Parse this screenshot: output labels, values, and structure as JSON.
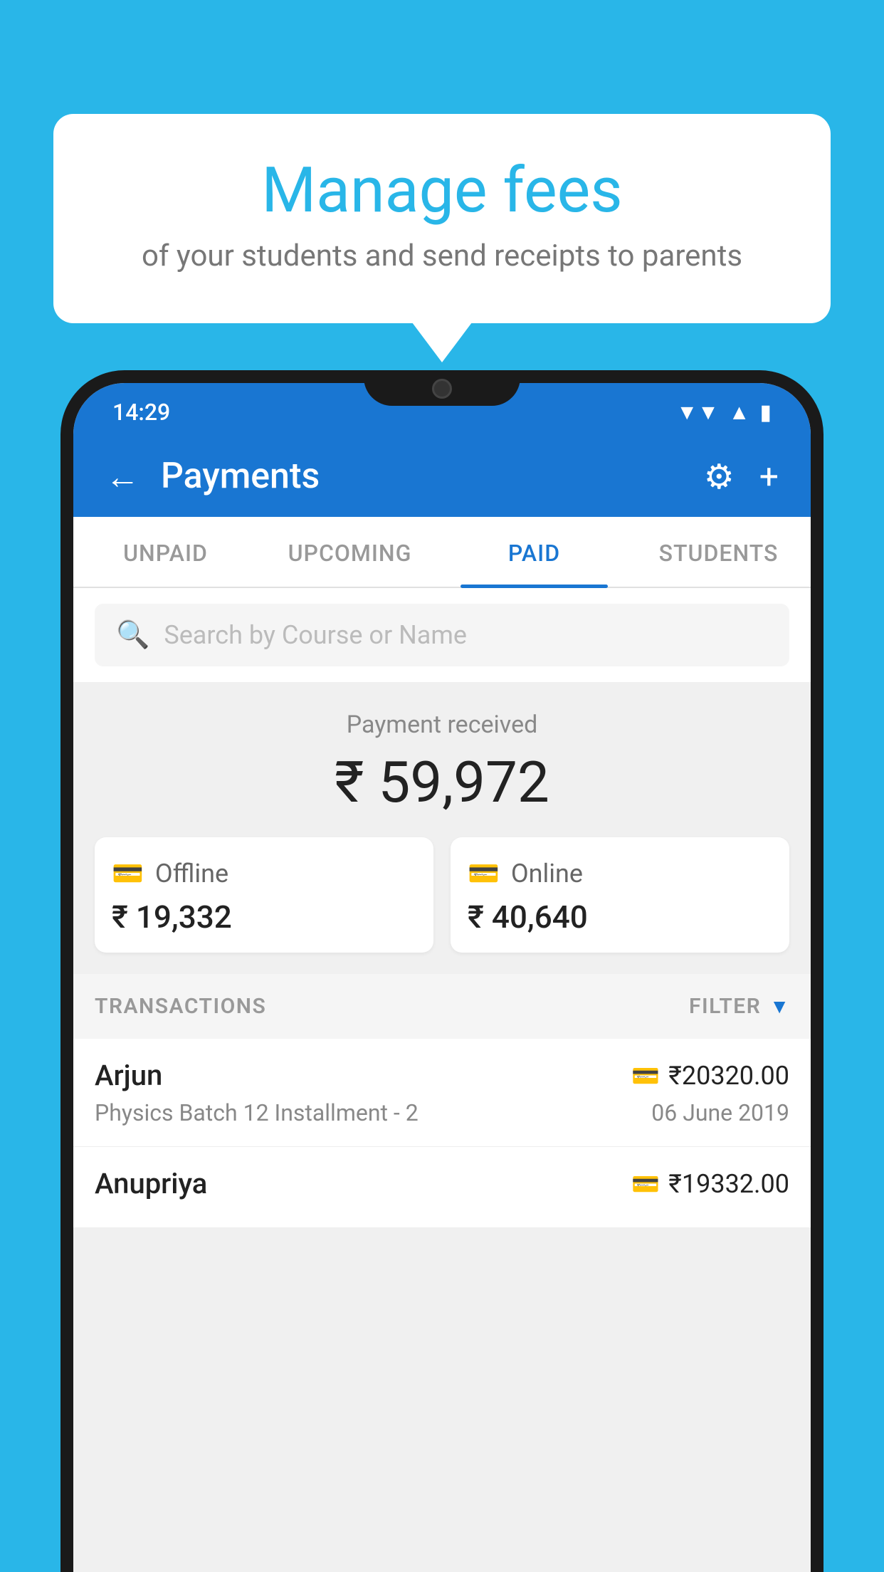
{
  "background_color": "#29b6e8",
  "speech_bubble": {
    "title": "Manage fees",
    "subtitle": "of your students and send receipts to parents"
  },
  "status_bar": {
    "time": "14:29",
    "wifi_icon": "▾",
    "signal_icon": "▲",
    "battery_icon": "▮"
  },
  "app_bar": {
    "title": "Payments",
    "back_icon": "←",
    "settings_icon": "⚙",
    "add_icon": "+"
  },
  "tabs": [
    {
      "label": "UNPAID",
      "active": false
    },
    {
      "label": "UPCOMING",
      "active": false
    },
    {
      "label": "PAID",
      "active": true
    },
    {
      "label": "STUDENTS",
      "active": false
    }
  ],
  "search": {
    "placeholder": "Search by Course or Name"
  },
  "payment_summary": {
    "label": "Payment received",
    "total": "₹ 59,972",
    "offline_label": "Offline",
    "offline_amount": "₹ 19,332",
    "online_label": "Online",
    "online_amount": "₹ 40,640"
  },
  "transactions_header": {
    "label": "TRANSACTIONS",
    "filter_label": "FILTER"
  },
  "transactions": [
    {
      "name": "Arjun",
      "amount": "₹20320.00",
      "course": "Physics Batch 12 Installment - 2",
      "date": "06 June 2019",
      "type": "online"
    },
    {
      "name": "Anupriya",
      "amount": "₹19332.00",
      "course": "",
      "date": "",
      "type": "offline"
    }
  ]
}
